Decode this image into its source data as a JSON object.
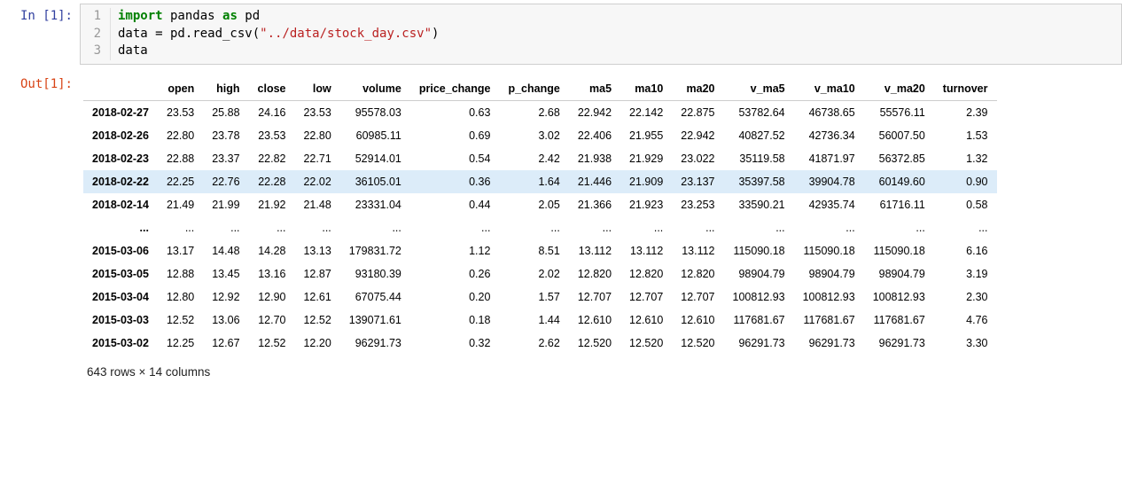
{
  "input": {
    "prompt": "In  [1]:",
    "code_lines": [
      {
        "n": "1",
        "tokens": [
          [
            "kw-import",
            "import"
          ],
          [
            "nm",
            " pandas "
          ],
          [
            "kw-as",
            "as"
          ],
          [
            "nm",
            " pd"
          ]
        ]
      },
      {
        "n": "2",
        "tokens": [
          [
            "nm",
            "data = pd.read_csv("
          ],
          [
            "str",
            "\"../data/stock_day.csv\""
          ],
          [
            "nm",
            ")"
          ]
        ]
      },
      {
        "n": "3",
        "tokens": [
          [
            "nm",
            "data"
          ]
        ]
      }
    ]
  },
  "output": {
    "prompt": "Out[1]:",
    "columns": [
      "open",
      "high",
      "close",
      "low",
      "volume",
      "price_change",
      "p_change",
      "ma5",
      "ma10",
      "ma20",
      "v_ma5",
      "v_ma10",
      "v_ma20",
      "turnover"
    ],
    "head_index": [
      "2018-02-27",
      "2018-02-26",
      "2018-02-23",
      "2018-02-22",
      "2018-02-14"
    ],
    "head_rows": [
      [
        "23.53",
        "25.88",
        "24.16",
        "23.53",
        "95578.03",
        "0.63",
        "2.68",
        "22.942",
        "22.142",
        "22.875",
        "53782.64",
        "46738.65",
        "55576.11",
        "2.39"
      ],
      [
        "22.80",
        "23.78",
        "23.53",
        "22.80",
        "60985.11",
        "0.69",
        "3.02",
        "22.406",
        "21.955",
        "22.942",
        "40827.52",
        "42736.34",
        "56007.50",
        "1.53"
      ],
      [
        "22.88",
        "23.37",
        "22.82",
        "22.71",
        "52914.01",
        "0.54",
        "2.42",
        "21.938",
        "21.929",
        "23.022",
        "35119.58",
        "41871.97",
        "56372.85",
        "1.32"
      ],
      [
        "22.25",
        "22.76",
        "22.28",
        "22.02",
        "36105.01",
        "0.36",
        "1.64",
        "21.446",
        "21.909",
        "23.137",
        "35397.58",
        "39904.78",
        "60149.60",
        "0.90"
      ],
      [
        "21.49",
        "21.99",
        "21.92",
        "21.48",
        "23331.04",
        "0.44",
        "2.05",
        "21.366",
        "21.923",
        "23.253",
        "33590.21",
        "42935.74",
        "61716.11",
        "0.58"
      ]
    ],
    "ellipsis": "...",
    "tail_index": [
      "2015-03-06",
      "2015-03-05",
      "2015-03-04",
      "2015-03-03",
      "2015-03-02"
    ],
    "tail_rows": [
      [
        "13.17",
        "14.48",
        "14.28",
        "13.13",
        "179831.72",
        "1.12",
        "8.51",
        "13.112",
        "13.112",
        "13.112",
        "115090.18",
        "115090.18",
        "115090.18",
        "6.16"
      ],
      [
        "12.88",
        "13.45",
        "13.16",
        "12.87",
        "93180.39",
        "0.26",
        "2.02",
        "12.820",
        "12.820",
        "12.820",
        "98904.79",
        "98904.79",
        "98904.79",
        "3.19"
      ],
      [
        "12.80",
        "12.92",
        "12.90",
        "12.61",
        "67075.44",
        "0.20",
        "1.57",
        "12.707",
        "12.707",
        "12.707",
        "100812.93",
        "100812.93",
        "100812.93",
        "2.30"
      ],
      [
        "12.52",
        "13.06",
        "12.70",
        "12.52",
        "139071.61",
        "0.18",
        "1.44",
        "12.610",
        "12.610",
        "12.610",
        "117681.67",
        "117681.67",
        "117681.67",
        "4.76"
      ],
      [
        "12.25",
        "12.67",
        "12.52",
        "12.20",
        "96291.73",
        "0.32",
        "2.62",
        "12.520",
        "12.520",
        "12.520",
        "96291.73",
        "96291.73",
        "96291.73",
        "3.30"
      ]
    ],
    "summary": "643 rows × 14 columns"
  },
  "highlight_row": 3
}
